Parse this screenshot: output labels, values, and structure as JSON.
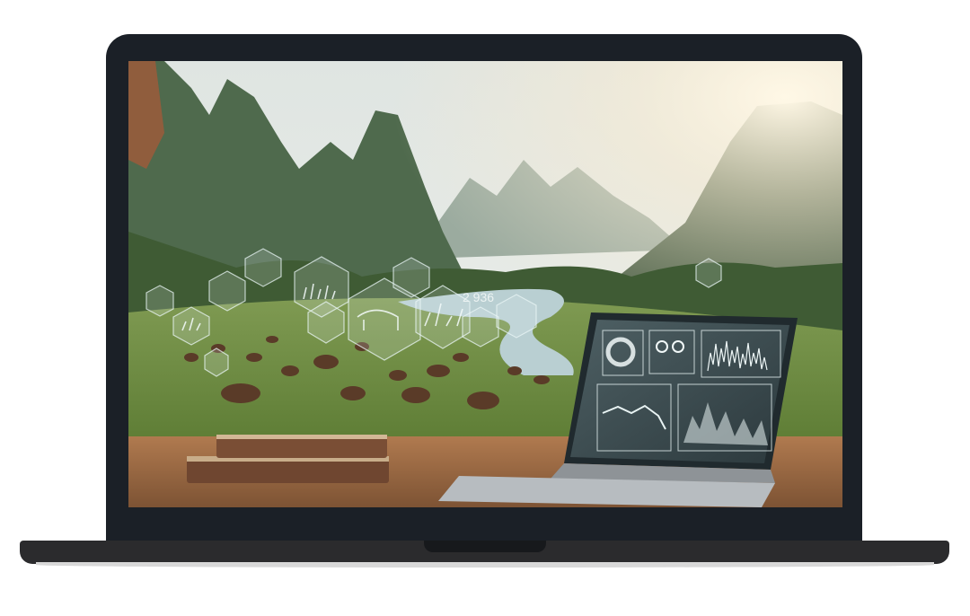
{
  "device": {
    "type": "laptop mockup"
  },
  "photo": {
    "subject_elements": [
      "mountains",
      "river",
      "grazing-animals",
      "hexagon-data-overlays",
      "open-laptop-dashboard",
      "books",
      "wooden-table",
      "sun-rays"
    ],
    "overlay_text": "2 936",
    "colors": {
      "sky": "#e6e9e4",
      "mountain": "#48604a",
      "grass": "#7c9a4a",
      "river": "#b9cfd2",
      "table": "#9a6b46",
      "frame": "#1b2027"
    }
  }
}
